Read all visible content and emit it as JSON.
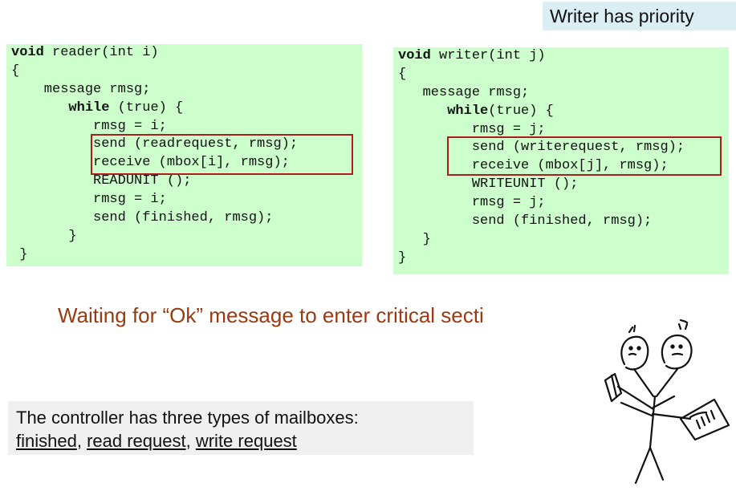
{
  "badge": {
    "text": "Writer has priority"
  },
  "reader_code": [
    "void reader(int i)",
    "{",
    "    message rmsg;",
    "       while (true) {",
    "          rmsg = i;",
    "          send (readrequest, rmsg);",
    "          receive (mbox[i], rmsg);",
    "          READUNIT ();",
    "          rmsg = i;",
    "          send (finished, rmsg);",
    "       }",
    " }"
  ],
  "writer_code": [
    "void writer(int j)",
    "{",
    "   message rmsg;",
    "      while(true) {",
    "         rmsg = j;",
    "         send (writerequest, rmsg);",
    "         receive (mbox[j], rmsg);",
    "         WRITEUNIT ();",
    "         rmsg = j;",
    "         send (finished, rmsg);",
    "   }",
    "}"
  ],
  "waiting_text": "Waiting for “Ok” message to enter critical secti",
  "note": {
    "line1": "The controller has three types of mailboxes:",
    "mailbox1": "finished",
    "mailbox2": "read request",
    "mailbox3": "write request",
    "sep1": ", ",
    "sep2": ", "
  },
  "colors": {
    "code_bg": "#ccffcc",
    "badge_bg": "#daeef3",
    "highlight_border": "#b01c1c",
    "waiting_text": "#9a3a12",
    "note_bg": "#f0f0f0"
  }
}
